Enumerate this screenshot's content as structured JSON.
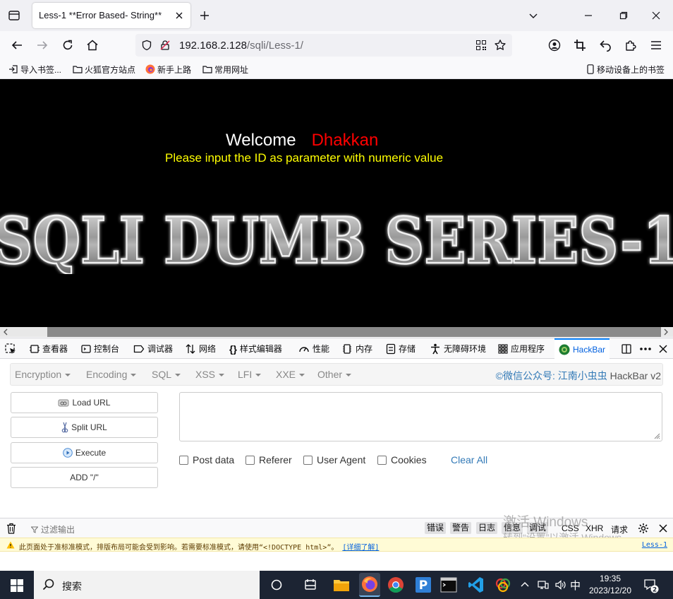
{
  "browser": {
    "tab_title": "Less-1 **Error Based- String**",
    "url_host": "192.168.2.128",
    "url_path": "/sqli/Less-1/"
  },
  "bookmarks": {
    "items": [
      "导入书签...",
      "火狐官方站点",
      "新手上路",
      "常用网址"
    ],
    "mobile": "移动设备上的书签"
  },
  "page": {
    "welcome": "Welcome",
    "name": "Dhakkan",
    "instruction": "Please input the ID as parameter with numeric value",
    "banner": "SQLI DUMB SERIES-1"
  },
  "devtools": {
    "tabs": [
      "查看器",
      "控制台",
      "调试器",
      "网络",
      "样式编辑器",
      "性能",
      "内存",
      "存储",
      "无障碍环境",
      "应用程序",
      "HackBar"
    ]
  },
  "hackbar": {
    "menu": [
      "Encryption",
      "Encoding",
      "SQL",
      "XSS",
      "LFI",
      "XXE",
      "Other"
    ],
    "brand": "©微信公众号: 江南小虫虫",
    "version": "HackBar v2",
    "buttons": [
      "Load URL",
      "Split URL",
      "Execute",
      "ADD \"/\""
    ],
    "checkboxes": [
      "Post data",
      "Referer",
      "User Agent",
      "Cookies"
    ],
    "clear_all": "Clear All"
  },
  "console": {
    "filter_placeholder": "过滤输出",
    "levels": [
      "错误",
      "警告",
      "日志",
      "信息",
      "调试"
    ],
    "extras": [
      "CSS",
      "XHR",
      "请求"
    ],
    "warning": "此页面处于准标准模式，排版布局可能会受到影响。若需要标准模式，请使用“<!DOCTYPE html>”。",
    "warning_link": "[详细了解]",
    "warning_source": "Less-1"
  },
  "watermark": {
    "line1": "激活 Windows",
    "line2": "转到“设置”以激活 Windows。"
  },
  "taskbar": {
    "search": "搜索",
    "ime": "中",
    "time": "19:35",
    "date": "2023/12/20",
    "notifications": "2"
  }
}
